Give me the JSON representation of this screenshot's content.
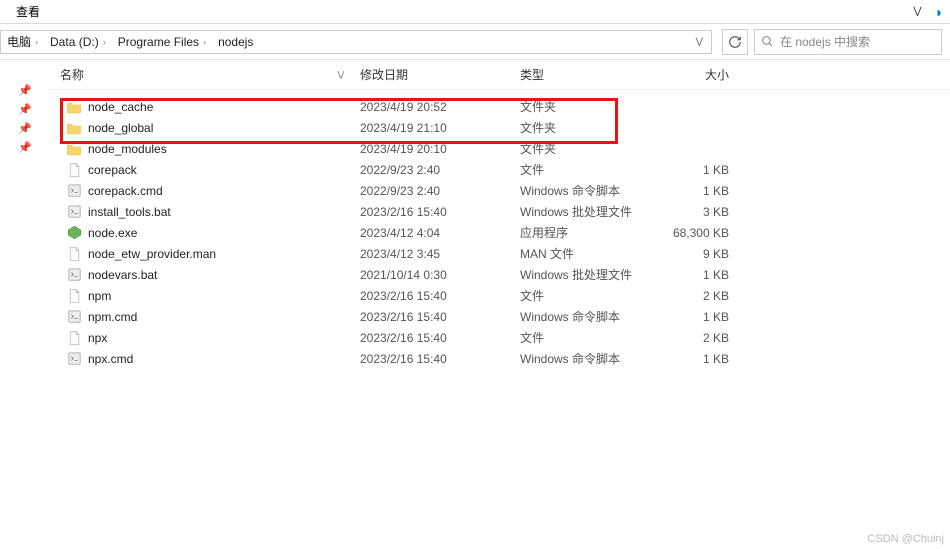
{
  "toolbar": {
    "view_label": "查看"
  },
  "breadcrumb": {
    "segments": [
      "电脑",
      "Data (D:)",
      "Programe Files",
      "nodejs"
    ]
  },
  "refresh_title": "刷新",
  "search": {
    "placeholder": "在 nodejs 中搜索"
  },
  "columns": {
    "name": "名称",
    "date": "修改日期",
    "type": "类型",
    "size": "大小"
  },
  "files": [
    {
      "icon": "folder",
      "name": "node_cache",
      "date": "2023/4/19 20:52",
      "type": "文件夹",
      "size": ""
    },
    {
      "icon": "folder",
      "name": "node_global",
      "date": "2023/4/19 21:10",
      "type": "文件夹",
      "size": ""
    },
    {
      "icon": "folder",
      "name": "node_modules",
      "date": "2023/4/19 20:10",
      "type": "文件夹",
      "size": ""
    },
    {
      "icon": "file",
      "name": "corepack",
      "date": "2022/9/23 2:40",
      "type": "文件",
      "size": "1 KB"
    },
    {
      "icon": "cmd",
      "name": "corepack.cmd",
      "date": "2022/9/23 2:40",
      "type": "Windows 命令脚本",
      "size": "1 KB"
    },
    {
      "icon": "cmd",
      "name": "install_tools.bat",
      "date": "2023/2/16 15:40",
      "type": "Windows 批处理文件",
      "size": "3 KB"
    },
    {
      "icon": "exe",
      "name": "node.exe",
      "date": "2023/4/12 4:04",
      "type": "应用程序",
      "size": "68,300 KB"
    },
    {
      "icon": "file",
      "name": "node_etw_provider.man",
      "date": "2023/4/12 3:45",
      "type": "MAN 文件",
      "size": "9 KB"
    },
    {
      "icon": "cmd",
      "name": "nodevars.bat",
      "date": "2021/10/14 0:30",
      "type": "Windows 批处理文件",
      "size": "1 KB"
    },
    {
      "icon": "file",
      "name": "npm",
      "date": "2023/2/16 15:40",
      "type": "文件",
      "size": "2 KB"
    },
    {
      "icon": "cmd",
      "name": "npm.cmd",
      "date": "2023/2/16 15:40",
      "type": "Windows 命令脚本",
      "size": "1 KB"
    },
    {
      "icon": "file",
      "name": "npx",
      "date": "2023/2/16 15:40",
      "type": "文件",
      "size": "2 KB"
    },
    {
      "icon": "cmd",
      "name": "npx.cmd",
      "date": "2023/2/16 15:40",
      "type": "Windows 命令脚本",
      "size": "1 KB"
    }
  ],
  "watermark": "CSDN @Chuinj"
}
